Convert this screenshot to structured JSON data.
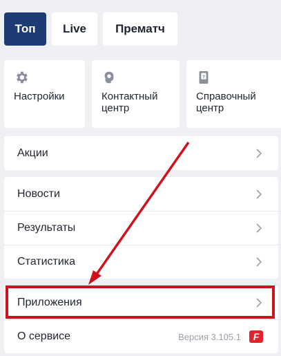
{
  "tabs": [
    {
      "label": "Топ",
      "active": true
    },
    {
      "label": "Live",
      "active": false
    },
    {
      "label": "Прематч",
      "active": false
    }
  ],
  "tiles": [
    {
      "icon": "gear-icon",
      "label": "Настройки"
    },
    {
      "icon": "headset-icon",
      "label": "Контактный\nцентр"
    },
    {
      "icon": "help-book-icon",
      "label": "Справочный\nцентр"
    }
  ],
  "menu": {
    "promotions": "Акции",
    "news": "Новости",
    "results": "Результаты",
    "statistics": "Статистика",
    "apps": "Приложения",
    "about": "О сервисе",
    "version": "Версия 3.105.1",
    "brand_letter": "F"
  },
  "colors": {
    "accent": "#1f3b73",
    "highlight": "#d0111b",
    "brand": "#e2242c",
    "background": "#eef0f3"
  }
}
